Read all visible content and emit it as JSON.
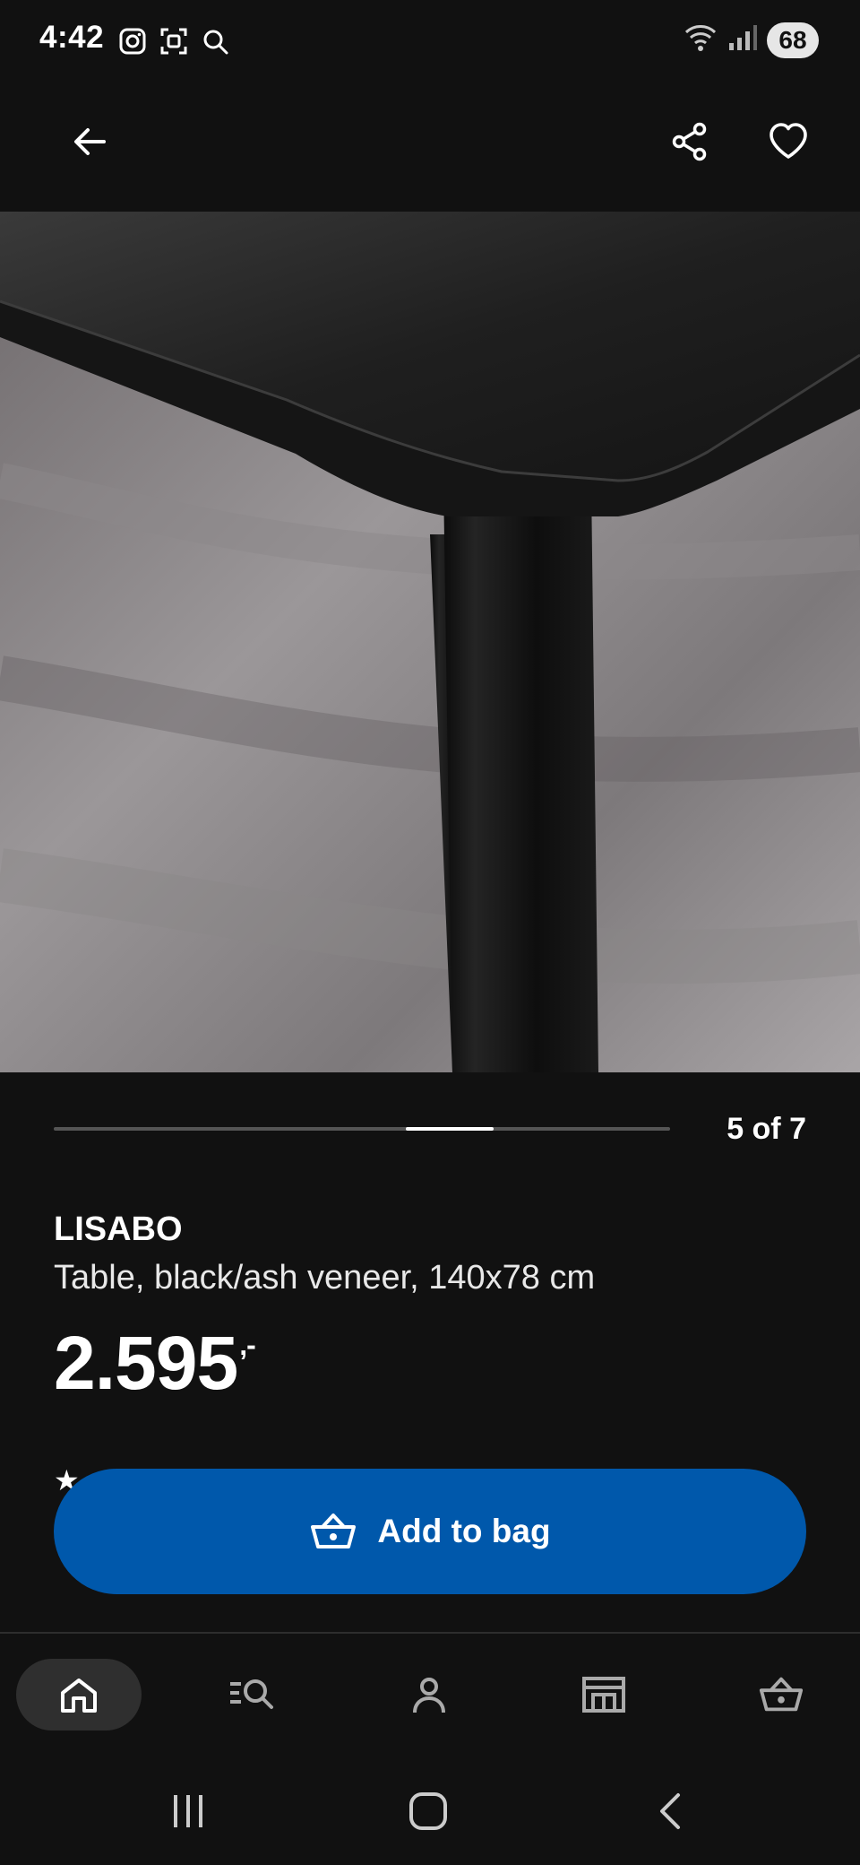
{
  "status_bar": {
    "time": "4:42",
    "left_icons": [
      "instagram-icon",
      "scan-icon",
      "search-icon"
    ],
    "right_icons": [
      "wifi-icon",
      "signal-icon"
    ],
    "battery": "68"
  },
  "app_bar": {
    "icons": [
      "back-arrow-icon",
      "share-icon",
      "heart-icon"
    ]
  },
  "gallery": {
    "current": 5,
    "total": 7,
    "counter_text": "5 of 7",
    "image_subject": "product-photo-table-corner"
  },
  "product": {
    "brand": "LISABO",
    "description": "Table, black/ash veneer, 140x78 cm",
    "price": "2.595",
    "price_suffix": ",-"
  },
  "cta": {
    "label": "Add to bag",
    "icon": "basket-icon",
    "color": "#0058ab"
  },
  "bottom_nav": {
    "items": [
      {
        "icon": "home-icon",
        "active": true
      },
      {
        "icon": "search-list-icon",
        "active": false
      },
      {
        "icon": "profile-icon",
        "active": false
      },
      {
        "icon": "store-icon",
        "active": false
      },
      {
        "icon": "basket-icon",
        "active": false
      }
    ]
  },
  "system_nav": {
    "icons": [
      "recents-icon",
      "home-icon",
      "back-icon"
    ]
  },
  "colors": {
    "background": "#111111",
    "accent": "#0058ab",
    "text": "#ffffff"
  }
}
